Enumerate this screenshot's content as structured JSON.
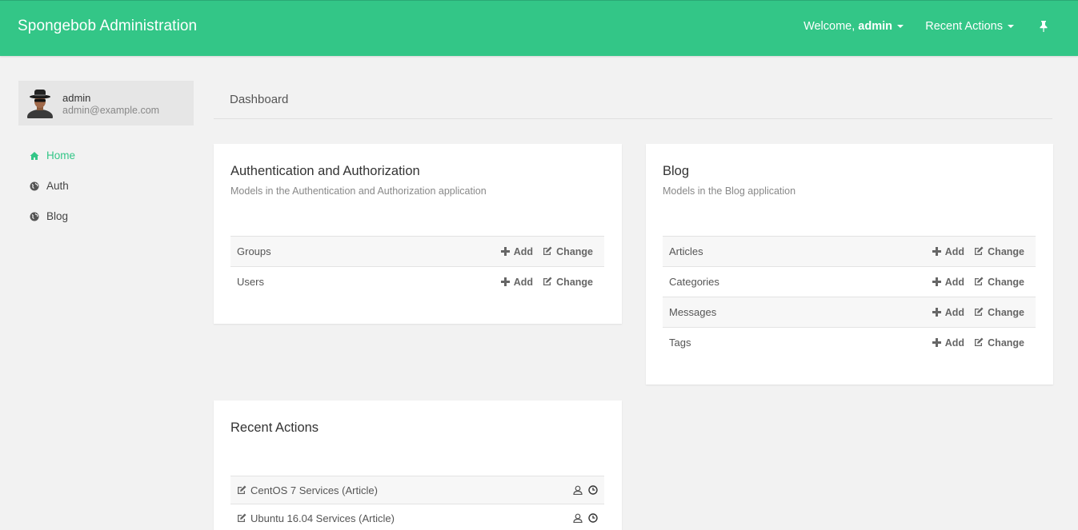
{
  "header": {
    "brand": "Spongebob Administration",
    "welcome_prefix": "Welcome,",
    "welcome_user": "admin",
    "recent_actions": "Recent Actions",
    "pin_icon": "thumbtack-icon",
    "accent_color": "#33c687"
  },
  "sidebar": {
    "user": {
      "name": "admin",
      "email": "admin@example.com"
    },
    "items": [
      {
        "label": "Home",
        "icon": "home-icon",
        "active": true
      },
      {
        "label": "Auth",
        "icon": "globe-icon",
        "active": false
      },
      {
        "label": "Blog",
        "icon": "globe-icon",
        "active": false
      }
    ]
  },
  "main": {
    "title": "Dashboard",
    "apps": [
      {
        "title": "Authentication and Authorization",
        "subtitle": "Models in the Authentication and Authorization application",
        "models": [
          {
            "name": "Groups",
            "add": "Add",
            "change": "Change"
          },
          {
            "name": "Users",
            "add": "Add",
            "change": "Change"
          }
        ]
      },
      {
        "title": "Blog",
        "subtitle": "Models in the Blog application",
        "models": [
          {
            "name": "Articles",
            "add": "Add",
            "change": "Change"
          },
          {
            "name": "Categories",
            "add": "Add",
            "change": "Change"
          },
          {
            "name": "Messages",
            "add": "Add",
            "change": "Change"
          },
          {
            "name": "Tags",
            "add": "Add",
            "change": "Change"
          }
        ]
      }
    ],
    "recent": {
      "title": "Recent Actions",
      "items": [
        {
          "label": "CentOS 7 Services (Article)"
        },
        {
          "label": "Ubuntu 16.04 Services (Article)"
        }
      ]
    }
  }
}
